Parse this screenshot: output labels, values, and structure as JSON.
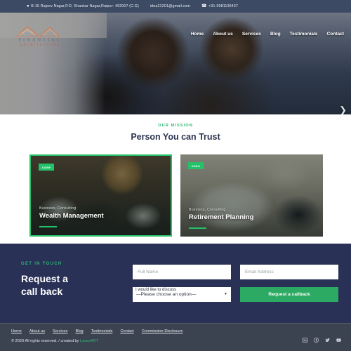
{
  "topbar": {
    "address": "B-15 Rajeev Nagar,P.O, Shankar Nagar,Raipur- 492007 (C.G)",
    "email": "idea21201@gmail.com",
    "phone": "+91-9981136437",
    "address_icon": "location-pin-icon",
    "email_icon": "envelope-icon",
    "phone_icon": "phone-icon"
  },
  "logo": {
    "line1": "FINANCIAL",
    "line2": "ARCHITECTURE"
  },
  "nav": {
    "items": [
      {
        "label": "Home"
      },
      {
        "label": "About us"
      },
      {
        "label": "Services"
      },
      {
        "label": "Blog"
      },
      {
        "label": "Testimonials"
      },
      {
        "label": "Contact"
      }
    ]
  },
  "hero": {
    "next_arrow": "❯"
  },
  "mission": {
    "kicker": "OUR MISSION",
    "title": "Person You can Trust"
  },
  "cards": [
    {
      "badge": "case",
      "category": "Business, Consulting",
      "title": "Wealth Management"
    },
    {
      "badge": "case",
      "category": "Business, Consulting",
      "title": "Retirement Planning"
    }
  ],
  "cta": {
    "kicker": "GET IN TOUCH",
    "heading_line1": "Request a",
    "heading_line2": "call back",
    "name_placeholder": "Full Name",
    "name_value": "",
    "email_placeholder": "Email Address",
    "email_value": "",
    "select_label": "I would like to discuss",
    "select_value": "—Please choose an option—",
    "submit_label": "Request a callback"
  },
  "footer": {
    "links": [
      {
        "label": "Home"
      },
      {
        "label": "About us"
      },
      {
        "label": "Services"
      },
      {
        "label": "Blog"
      },
      {
        "label": "Testimonials"
      },
      {
        "label": "Contact"
      },
      {
        "label": "Commission-Disclosure"
      }
    ],
    "copyright_prefix": "© 2020 All rights reserved. / created by ",
    "brand": "LassoART",
    "social": [
      {
        "name": "linkedin-icon"
      },
      {
        "name": "facebook-icon"
      },
      {
        "name": "twitter-icon"
      },
      {
        "name": "youtube-icon"
      }
    ]
  },
  "colors": {
    "accent_green": "#24c268",
    "navy": "#2a3157",
    "topbar": "#3c4a63",
    "footer": "#3b4350"
  }
}
